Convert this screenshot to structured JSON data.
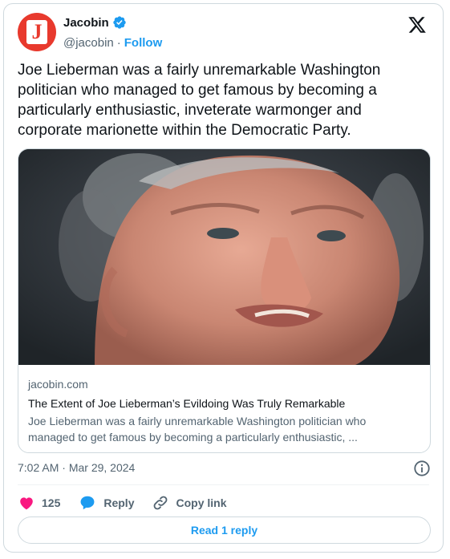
{
  "author": {
    "display_name": "Jacobin",
    "handle": "@jacobin",
    "separator": "·",
    "follow_label": "Follow",
    "avatar_letter": "J"
  },
  "tweet": {
    "text": "Joe Lieberman was a fairly unremarkable Washington\npolitician who managed to get famous by becoming a\nparticularly enthusiastic, inveterate warmonger and\ncorporate marionette within the Democratic Party."
  },
  "link_card": {
    "domain": "jacobin.com",
    "title": "The Extent of Joe Lieberman’s Evildoing Was Truly Remarkable",
    "description_line1": "Joe Lieberman was a fairly unremarkable Washington politician who",
    "description_line2": "managed to get famous by becoming a particularly enthusiastic, ..."
  },
  "meta": {
    "time": "7:02 AM",
    "separator": "·",
    "date": "Mar 29, 2024"
  },
  "actions": {
    "like_count": "125",
    "reply_label": "Reply",
    "copy_link_label": "Copy link"
  },
  "read_reply_label": "Read 1 reply",
  "colors": {
    "accent": "#1d9bf0",
    "like": "#f91880",
    "brand": "#e8392d",
    "text": "#0f1419",
    "muted": "#536471"
  },
  "icons": [
    "verified-badge-icon",
    "x-logo-icon",
    "info-icon",
    "heart-icon",
    "reply-bubble-icon",
    "link-icon"
  ]
}
